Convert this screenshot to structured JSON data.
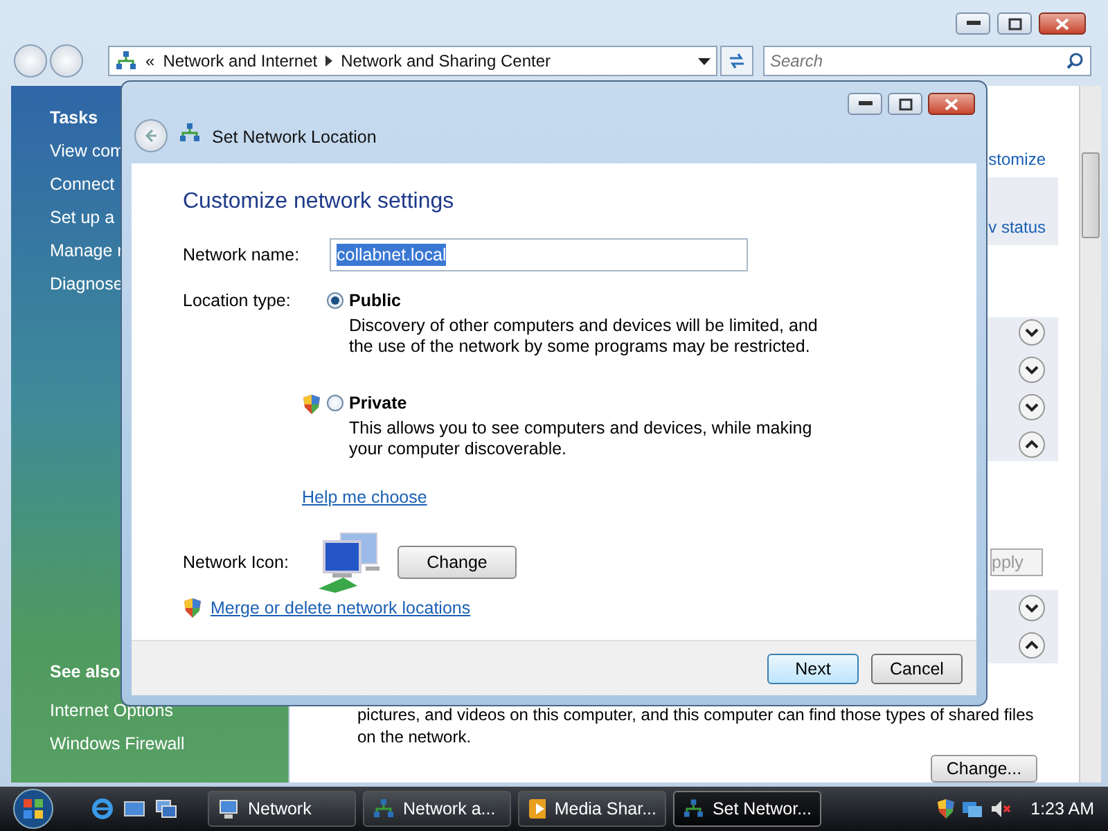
{
  "explorer": {
    "address": {
      "overflow": "«",
      "crumbs": [
        "Network and Internet",
        "Network and Sharing Center"
      ]
    },
    "search": {
      "placeholder": "Search"
    },
    "sidebar": {
      "tasks_title": "Tasks",
      "tasks": [
        "View com",
        "Connect",
        "Set up a",
        "Manage r",
        "Diagnose"
      ],
      "see_also_title": "See also",
      "see_also": [
        "Internet Options",
        "Windows Firewall"
      ]
    },
    "main": {
      "customize_link": "stomize",
      "status_link": "v status",
      "expanders": [
        {
          "expanded": false
        },
        {
          "expanded": false
        },
        {
          "expanded": false
        },
        {
          "expanded": true
        }
      ],
      "apply_button": {
        "label": "pply",
        "disabled": true
      },
      "expanders_2": [
        {
          "expanded": false
        },
        {
          "expanded": true
        }
      ],
      "sharing_text": [
        "pictures, and videos on this computer, and this computer can find those types of shared files",
        "on the network."
      ],
      "change_button": "Change..."
    }
  },
  "dialog": {
    "title": "Set Network Location",
    "heading": "Customize network settings",
    "network_name": {
      "label": "Network name:",
      "value": "collabnet.local",
      "selected": true
    },
    "location_label": "Location type:",
    "locations": [
      {
        "name": "Public",
        "description": "Discovery of other computers and devices will be limited, and the use of the network by some programs may be restricted.",
        "selected": true,
        "shield": false
      },
      {
        "name": "Private",
        "description": "This allows you to see computers and devices, while making your computer discoverable.",
        "selected": false,
        "shield": true
      }
    ],
    "help_link": "Help me choose",
    "icon_label": "Network Icon:",
    "change_button": "Change",
    "merge_link": "Merge or delete network locations",
    "buttons": [
      {
        "label": "Next",
        "default": true
      },
      {
        "label": "Cancel",
        "default": false
      }
    ]
  },
  "taskbar": {
    "items": [
      {
        "label": "Network",
        "selected": false,
        "kind": "computer"
      },
      {
        "label": "Network a...",
        "selected": false,
        "kind": "network"
      },
      {
        "label": "Media Shar...",
        "selected": false,
        "kind": "media"
      },
      {
        "label": "Set Networ...",
        "selected": true,
        "kind": "setup"
      }
    ],
    "time": "1:23 AM"
  }
}
